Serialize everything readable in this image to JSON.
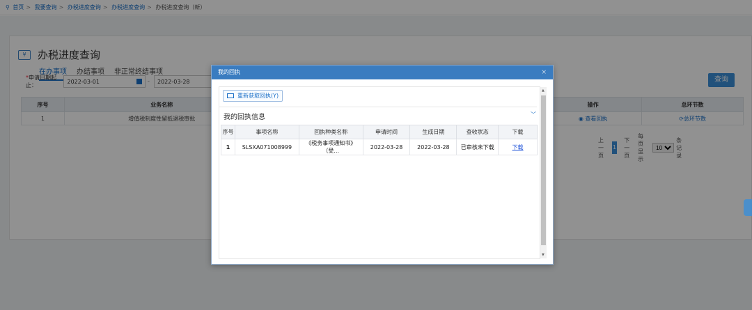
{
  "breadcrumb": [
    "首页",
    "我要查询",
    "办税进度查询",
    "办税进度查询"
  ],
  "breadcrumb_current": "办税进度查询（新）",
  "page": {
    "title": "办税进度查询"
  },
  "tabs": [
    "在办事项",
    "办结事项",
    "非正常终结事项"
  ],
  "filter": {
    "label": "申请日期起止：",
    "start": "2022-03-01",
    "end": "2022-03-28"
  },
  "query_label": "查询",
  "grid": {
    "headers": [
      "序号",
      "业务名称",
      "操作",
      "总环节数"
    ],
    "rows": [
      [
        "1",
        "增值税制度性留抵退税审批",
        "查看回执",
        "总环节数"
      ]
    ]
  },
  "pager": {
    "prev": "上一页",
    "page": "1",
    "next": "下一页",
    "per_page_label": "每页显示",
    "per_page": "10",
    "records_label": "条记录"
  },
  "modal": {
    "title": "我的回执",
    "close": "×",
    "refresh_label": "重新获取回执(Y)",
    "section_title": "我的回执信息",
    "headers": [
      "序号",
      "事项名称",
      "回执种类名称",
      "申请时间",
      "生成日期",
      "查收状态",
      "下载"
    ],
    "rows": [
      [
        "1",
        "SLSXA071008999",
        "《税务事项通知书》（受...",
        "2022-03-28",
        "2022-03-28",
        "已审核未下载",
        "下载"
      ]
    ]
  },
  "colors": {
    "accent": "#1a6fc7",
    "header_blue": "#3a7cc0"
  }
}
